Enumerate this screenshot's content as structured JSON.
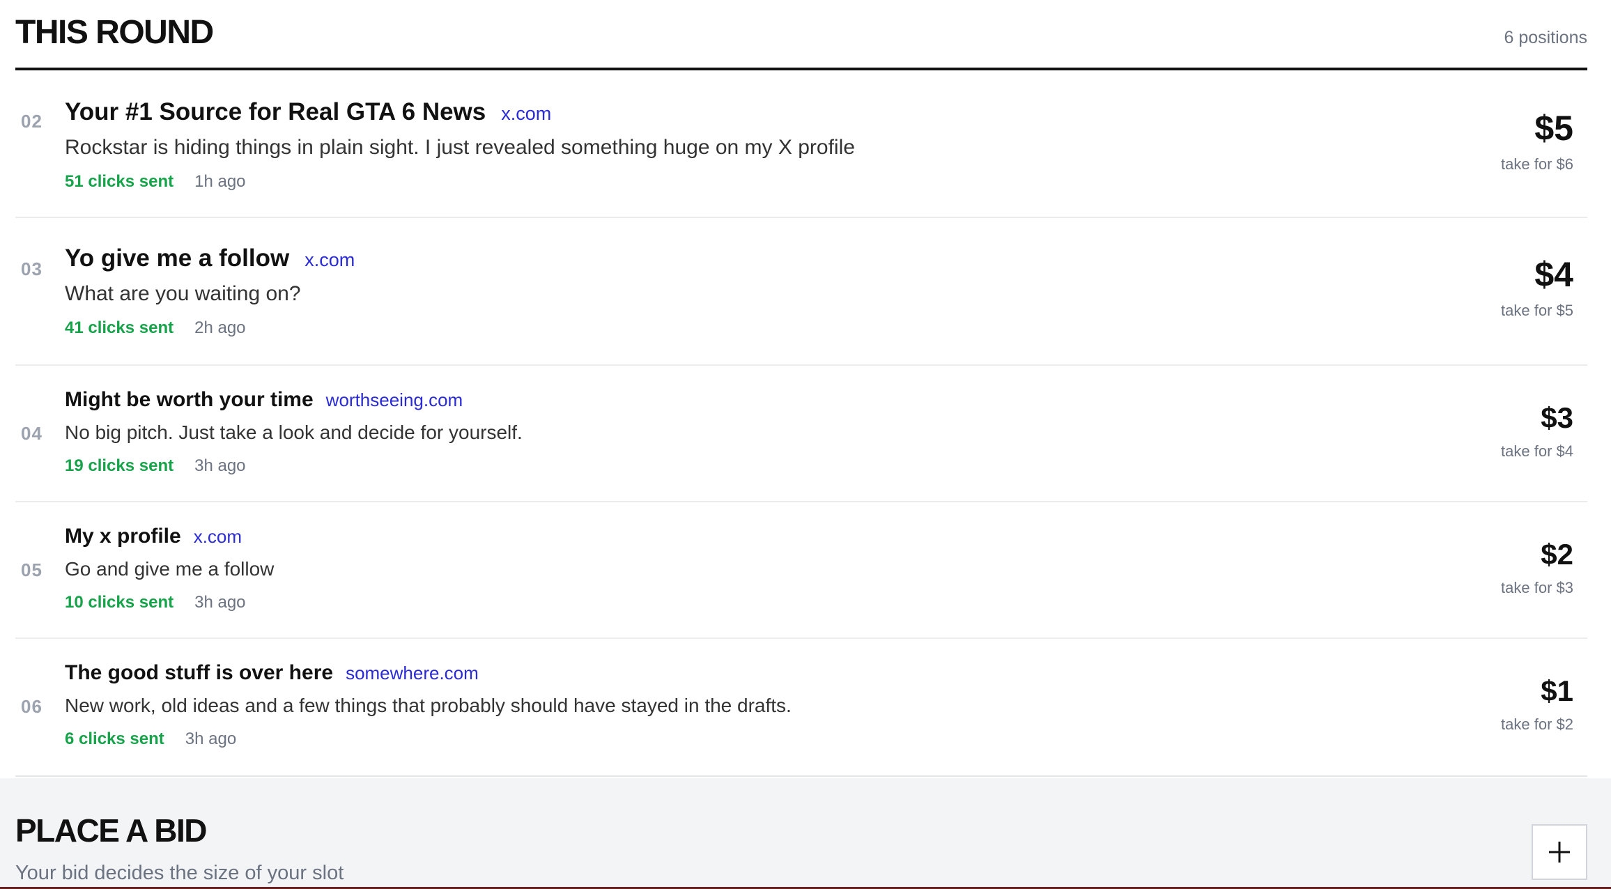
{
  "round": {
    "title": "THIS ROUND",
    "positions": "6 positions"
  },
  "slots": [
    {
      "rank": "02",
      "title": "Your #1 Source for Real GTA 6 News",
      "domain": "x.com",
      "description": "Rockstar is hiding things in plain sight. I just revealed something huge on my X profile",
      "clicks": "51 clicks sent",
      "ago": "1h ago",
      "price": "$5",
      "take": "take for $6"
    },
    {
      "rank": "03",
      "title": "Yo give me a follow",
      "domain": "x.com",
      "description": "What are you waiting on?",
      "clicks": "41 clicks sent",
      "ago": "2h ago",
      "price": "$4",
      "take": "take for $5"
    },
    {
      "rank": "04",
      "title": "Might be worth your time",
      "domain": "worthseeing.com",
      "description": "No big pitch. Just take a look and decide for yourself.",
      "clicks": "19 clicks sent",
      "ago": "3h ago",
      "price": "$3",
      "take": "take for $4"
    },
    {
      "rank": "05",
      "title": "My x profile",
      "domain": "x.com",
      "description": "Go and give me a follow",
      "clicks": "10 clicks sent",
      "ago": "3h ago",
      "price": "$2",
      "take": "take for $3"
    },
    {
      "rank": "06",
      "title": "The good stuff is over here",
      "domain": "somewhere.com",
      "description": "New work, old ideas and a few things that probably should have stayed in the drafts.",
      "clicks": "6 clicks sent",
      "ago": "3h ago",
      "price": "$1",
      "take": "take for $2"
    }
  ],
  "bid": {
    "title": "PLACE A BID",
    "subtitle": "Your bid decides the size of your slot",
    "expand_icon": "plus-icon"
  },
  "colors": {
    "link": "#2a2bd6",
    "clicks": "#16a34a",
    "muted": "#6b7280",
    "panel": "#f3f4f6"
  }
}
